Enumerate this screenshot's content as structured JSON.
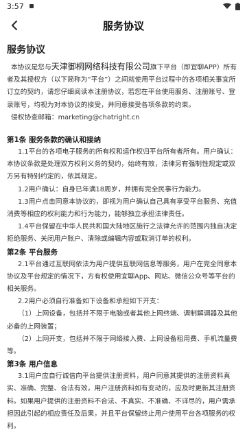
{
  "status_bar": {
    "time": "3:57"
  },
  "nav": {
    "title": "服务协议"
  },
  "doc": {
    "title": "服务协议",
    "intro_pre": "本协议是您与",
    "company": "天津御桐网络科技有限公司",
    "intro_post": "旗下平台（即宜聊APP）所有者及其授权方（以下简称为“平台”）之间就使用平台过程中的各项相关事宜所订立的契约，请您仔细阅读本注册协议，若您在平台使用服务、注册账号、登录账号，均视为对本协议的接受，并同意接受各项条款的约束。",
    "email_line": "侵权协查邮箱：marketing@chatright.cn",
    "sections": [
      {
        "heading": "第1条 服务条款的确认和接纳",
        "paragraphs": [
          "1.1平台的各项电子服务的所有权和运作权归平台所有者所有。用户确认：本协议条款是处理双方权利义务的契约，始终有效，法律另有强制性规定或双方另有特别约定的，依其规定。",
          "1.2用户确认：自身已年满18周岁，并拥有完全民事行为能力。",
          "1.3用户点击同意本协议的，即视为用户确认自己具有享受平台服务、充值消费等相应的权利能力和行为能力，能够独立承担法律责任。",
          "1.4平台保留在中华人民共和国大陆地区施行之法律允许的范围内独自决定拒绝服务、关闭用户账户、清除或编辑内容或取消订单的权利。"
        ]
      },
      {
        "heading": "第2条 平台服务",
        "paragraphs": [
          "2.1平台通过互联网依法为用户提供互联网信息等服务，用户在完全同意本协议及平台规定的情况下，方有权使用宜聊App、网站、微信公众号等平台的相关服务。",
          "2.2用户必须自行准备如下设备和承担如下开支：",
          "（1）上网设备，包括并不限于电脑或者其他上网终端、调制解调器及其他必备的上网装置；",
          "（2）上网开支，包括并不限于网络接入费、上网设备租用费、手机流量费等。"
        ]
      },
      {
        "heading": "第3条 用户信息",
        "paragraphs": [
          "3.1用户应自行诚信向平台提供注册资料，用户同意其提供的注册资料真实、准确、完整、合法有效，用户注册资料如有变动的，应及时更新其注册资料。如果用户提供的注册资料不合法、不真实、不准确、不详尽的，用户需承担因此引起的相应责任及后果，并且平台保留终止用户使用平台各项服务的权利。"
        ]
      }
    ]
  }
}
